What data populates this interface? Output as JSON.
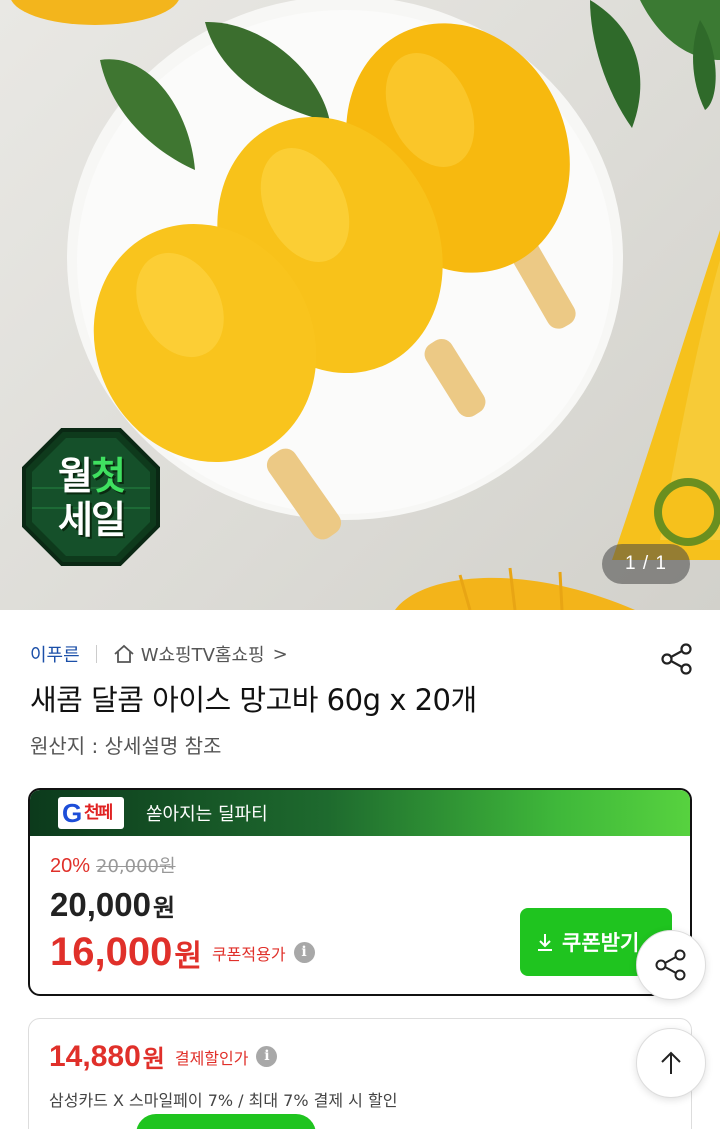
{
  "hero": {
    "badge_line1": "월",
    "badge_line1_accent": "첫",
    "badge_line2": "세일",
    "counter": "1 / 1"
  },
  "product": {
    "seller": "이푸른",
    "store": "W쇼핑TV홈쇼핑",
    "store_chevron": ">",
    "title": "새콤 달콤 아이스 망고바 60g x 20개",
    "origin": "원산지 : 상세설명 참조"
  },
  "deal": {
    "tag_letter": "G",
    "tag_text": "천페",
    "label": "쏟아지는 딜파티",
    "discount": "20%",
    "original_price": "20,000원",
    "price": "20,000",
    "price_unit": "원",
    "sale_price": "16,000",
    "sale_unit": "원",
    "coupon_note": "쿠폰적용가",
    "coupon_button": "쿠폰받기"
  },
  "payment": {
    "price": "14,880",
    "unit": "원",
    "note": "결제할인가",
    "detail": "삼성카드 X 스마일페이 7%  / 최대 7% 결제 시 할인"
  },
  "colors": {
    "accent_red": "#e0302a",
    "accent_green": "#1fc41f",
    "seller_blue": "#1b4fa8"
  },
  "icons": {
    "share": "share-icon",
    "home": "home-icon",
    "download": "download-icon",
    "up": "arrow-up-icon",
    "info": "info-icon"
  }
}
